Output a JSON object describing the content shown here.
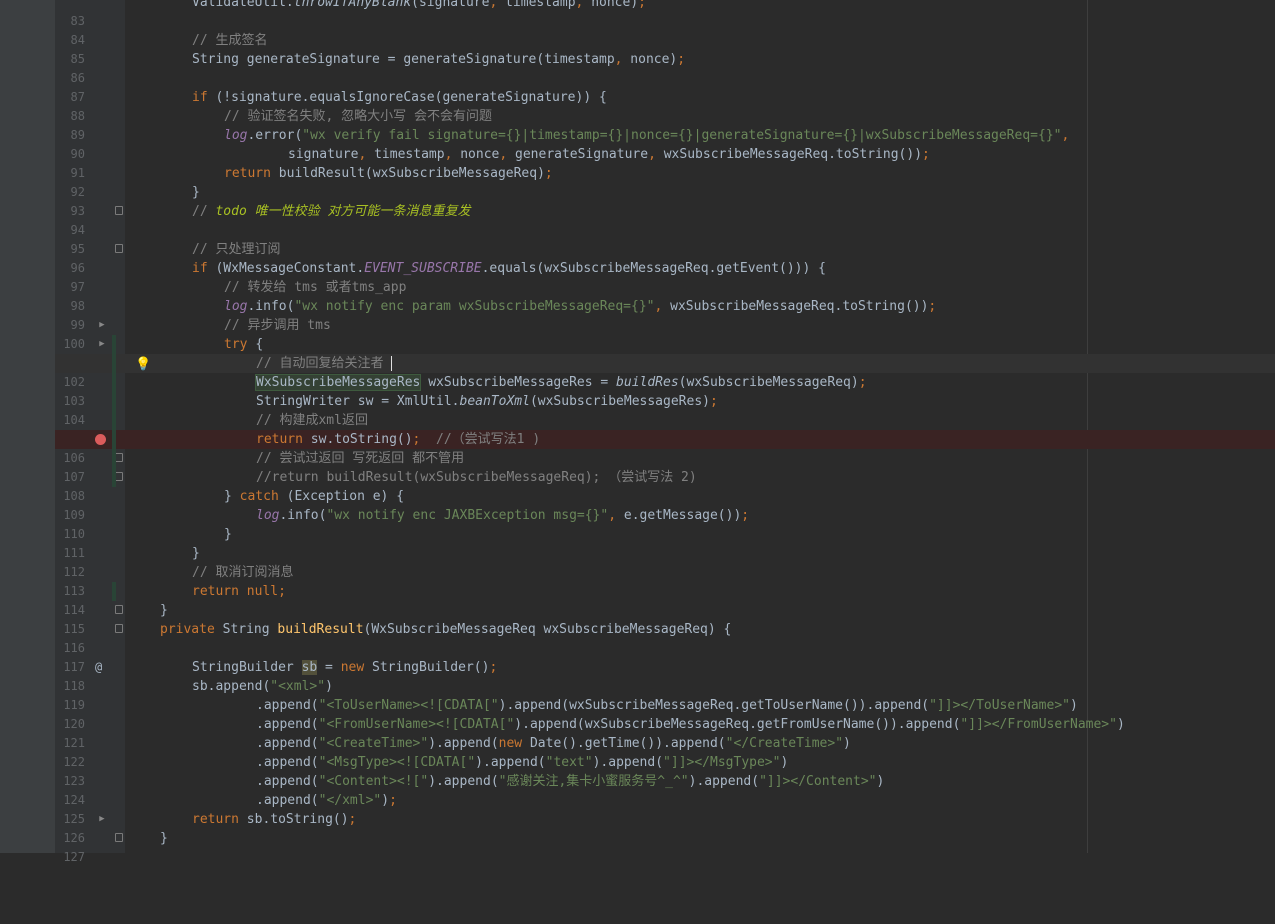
{
  "editor": {
    "theme": "darcula",
    "colors": {
      "background": "#2b2b2b",
      "gutter": "#313335",
      "keyword": "#cc7832",
      "string": "#6a8759",
      "comment": "#808080",
      "field": "#9876aa",
      "method_decl": "#ffc66d",
      "todo": "#a8c023",
      "breakpoint": "#db5c5c"
    },
    "current_line": 102,
    "breakpoint_line": 106,
    "lines": [
      {
        "n": "83",
        "t": "ValidateUtil.throwIfAnyBlank(signature, timestamp, nonce);"
      },
      {
        "n": "84",
        "t": ""
      },
      {
        "n": "85",
        "t": "// 生成签名"
      },
      {
        "n": "86",
        "t": "String generateSignature = generateSignature(timestamp, nonce);"
      },
      {
        "n": "87",
        "t": ""
      },
      {
        "n": "88",
        "t": "if (!signature.equalsIgnoreCase(generateSignature)) {"
      },
      {
        "n": "89",
        "t": "// 验证签名失败, 忽略大小写 会不会有问题"
      },
      {
        "n": "90",
        "t": "log.error(\"wx verify fail signature={}|timestamp={}|nonce={}|generateSignature={}|wxSubscribeMessageReq={}\","
      },
      {
        "n": "91",
        "t": "signature, timestamp, nonce, generateSignature, wxSubscribeMessageReq.toString());"
      },
      {
        "n": "92",
        "t": "return buildResult(wxSubscribeMessageReq);"
      },
      {
        "n": "93",
        "t": "}"
      },
      {
        "n": "94",
        "t": "// todo 唯一性校验 对方可能一条消息重复发"
      },
      {
        "n": "95",
        "t": ""
      },
      {
        "n": "96",
        "t": "// 只处理订阅"
      },
      {
        "n": "97",
        "t": "if (WxMessageConstant.EVENT_SUBSCRIBE.equals(wxSubscribeMessageReq.getEvent())) {"
      },
      {
        "n": "98",
        "t": "// 转发给 tms 或者tms_app"
      },
      {
        "n": "99",
        "t": "log.info(\"wx notify enc param wxSubscribeMessageReq={}\", wxSubscribeMessageReq.toString());"
      },
      {
        "n": "100",
        "t": "// 异步调用 tms"
      },
      {
        "n": "101",
        "t": "try {"
      },
      {
        "n": "102",
        "t": "// 自动回复给关注者 "
      },
      {
        "n": "103",
        "t": "WxSubscribeMessageRes wxSubscribeMessageRes = buildRes(wxSubscribeMessageReq);"
      },
      {
        "n": "104",
        "t": "StringWriter sw = XmlUtil.beanToXml(wxSubscribeMessageRes);"
      },
      {
        "n": "105",
        "t": "// 构建成xml返回"
      },
      {
        "n": "106",
        "t": "return sw.toString();  //（尝试写法1 )"
      },
      {
        "n": "107",
        "t": "// 尝试过返回 写死返回 都不管用"
      },
      {
        "n": "108",
        "t": "//return buildResult(wxSubscribeMessageReq); （尝试写法 2)"
      },
      {
        "n": "109",
        "t": "} catch (Exception e) {"
      },
      {
        "n": "110",
        "t": "log.info(\"wx notify enc JAXBException msg={}\", e.getMessage());"
      },
      {
        "n": "111",
        "t": "}"
      },
      {
        "n": "112",
        "t": "}"
      },
      {
        "n": "113",
        "t": "// 取消订阅消息"
      },
      {
        "n": "114",
        "t": "return null;"
      },
      {
        "n": "115",
        "t": "}"
      },
      {
        "n": "116",
        "t": "private String buildResult(WxSubscribeMessageReq wxSubscribeMessageReq) {"
      },
      {
        "n": "117",
        "t": ""
      },
      {
        "n": "118",
        "t": "StringBuilder sb = new StringBuilder();"
      },
      {
        "n": "119",
        "t": "sb.append(\"<xml>\")"
      },
      {
        "n": "120",
        "t": ".append(\"<ToUserName><![CDATA[\").append(wxSubscribeMessageReq.getToUserName()).append(\"]]></ToUserName>\")"
      },
      {
        "n": "121",
        "t": ".append(\"<FromUserName><![CDATA[\").append(wxSubscribeMessageReq.getFromUserName()).append(\"]]></FromUserName>\")"
      },
      {
        "n": "122",
        "t": ".append(\"<CreateTime>\").append(new Date().getTime()).append(\"</CreateTime>\")"
      },
      {
        "n": "123",
        "t": ".append(\"<MsgType><![CDATA[\").append(\"text\").append(\"]]></MsgType>\")"
      },
      {
        "n": "124",
        "t": ".append(\"<Content><![\").append(\"感谢关注,集卡小蜜服务号^_^\").append(\"]]></Content>\")"
      },
      {
        "n": "125",
        "t": ".append(\"</xml>\");"
      },
      {
        "n": "126",
        "t": "return sb.toString();"
      },
      {
        "n": "127",
        "t": "}"
      }
    ]
  }
}
